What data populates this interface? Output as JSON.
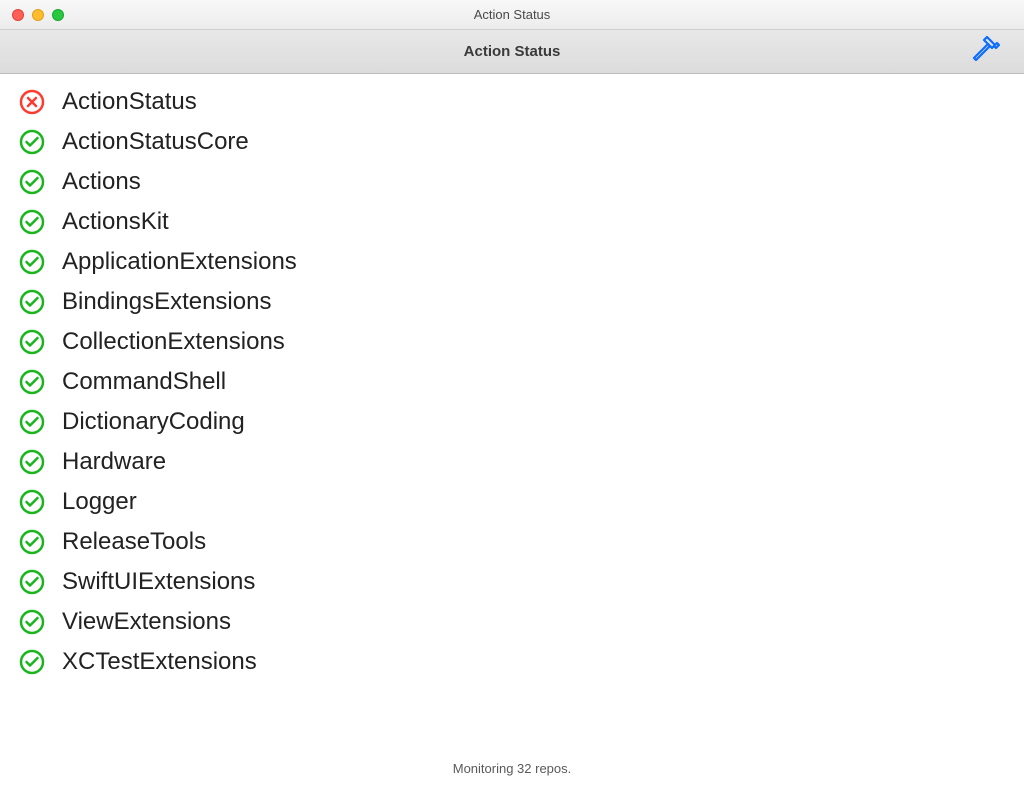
{
  "window": {
    "title": "Action Status"
  },
  "toolbar": {
    "title": "Action Status",
    "build_icon_color": "#0b6cff",
    "build_icon_name": "hammer-icon"
  },
  "status_colors": {
    "passing": "#18b61d",
    "failing": "#ff3b30"
  },
  "repos": [
    {
      "name": "ActionStatus",
      "status": "failing"
    },
    {
      "name": "ActionStatusCore",
      "status": "passing"
    },
    {
      "name": "Actions",
      "status": "passing"
    },
    {
      "name": "ActionsKit",
      "status": "passing"
    },
    {
      "name": "ApplicationExtensions",
      "status": "passing"
    },
    {
      "name": "BindingsExtensions",
      "status": "passing"
    },
    {
      "name": "CollectionExtensions",
      "status": "passing"
    },
    {
      "name": "CommandShell",
      "status": "passing"
    },
    {
      "name": "DictionaryCoding",
      "status": "passing"
    },
    {
      "name": "Hardware",
      "status": "passing"
    },
    {
      "name": "Logger",
      "status": "passing"
    },
    {
      "name": "ReleaseTools",
      "status": "passing"
    },
    {
      "name": "SwiftUIExtensions",
      "status": "passing"
    },
    {
      "name": "ViewExtensions",
      "status": "passing"
    },
    {
      "name": "XCTestExtensions",
      "status": "passing"
    }
  ],
  "footer": {
    "text": "Monitoring 32 repos."
  }
}
